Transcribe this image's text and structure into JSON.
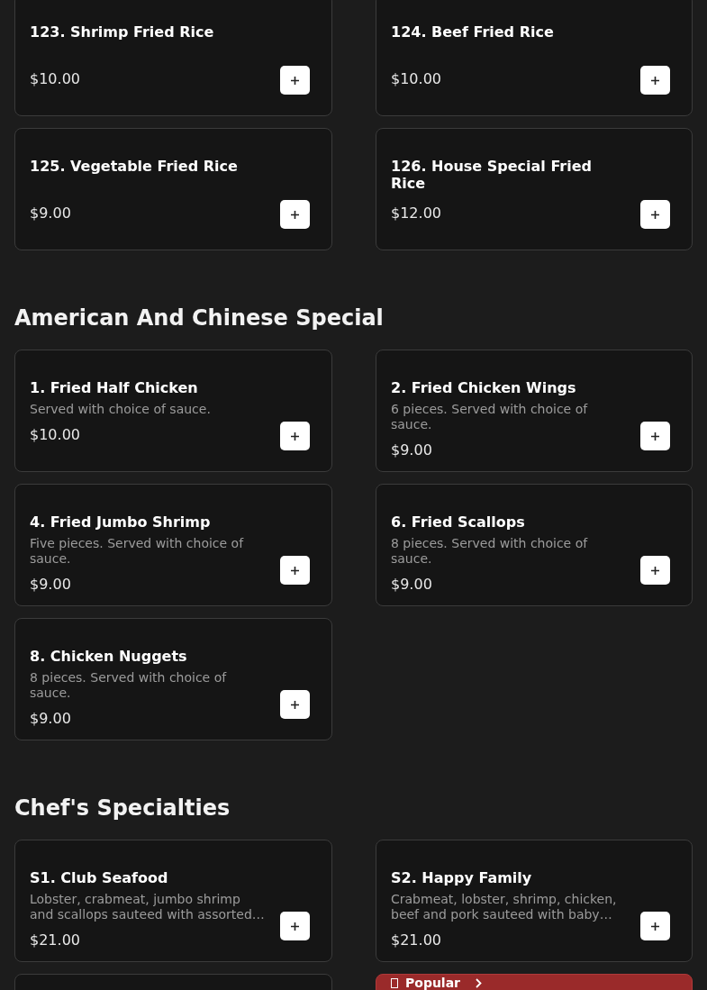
{
  "sections": [
    {
      "items": [
        {
          "name": "123. Shrimp Fried Rice",
          "price": "$10.00"
        },
        {
          "name": "124. Beef Fried Rice",
          "price": "$10.00"
        },
        {
          "name": "125. Vegetable Fried Rice",
          "price": "$9.00"
        },
        {
          "name": "126. House Special Fried Rice",
          "price": "$12.00"
        }
      ]
    },
    {
      "title": "American And Chinese Special",
      "items": [
        {
          "name": "1. Fried Half Chicken",
          "description": "Served with choice of sauce.",
          "price": "$10.00"
        },
        {
          "name": "2. Fried Chicken Wings",
          "description": "6 pieces. Served with choice of sauce.",
          "price": "$9.00"
        },
        {
          "name": "4. Fried Jumbo Shrimp",
          "description": "Five pieces. Served with choice of sauce.",
          "price": "$9.00"
        },
        {
          "name": "6. Fried Scallops",
          "description": "8 pieces. Served with choice of sauce.",
          "price": "$9.00"
        },
        {
          "name": "8. Chicken Nuggets",
          "description": "8 pieces. Served with choice of sauce.",
          "price": "$9.00"
        }
      ]
    },
    {
      "title": "Chef's Specialties",
      "items": [
        {
          "name": "S1. Club Seafood",
          "description": "Lobster, crabmeat, jumbo shrimp and scallops sauteed with assorted…",
          "price": "$21.00"
        },
        {
          "name": "S2. Happy Family",
          "description": "Crabmeat, lobster, shrimp, chicken, beef and pork sauteed with baby…",
          "price": "$21.00"
        }
      ]
    }
  ],
  "popular_button": {
    "label": "Popular"
  }
}
